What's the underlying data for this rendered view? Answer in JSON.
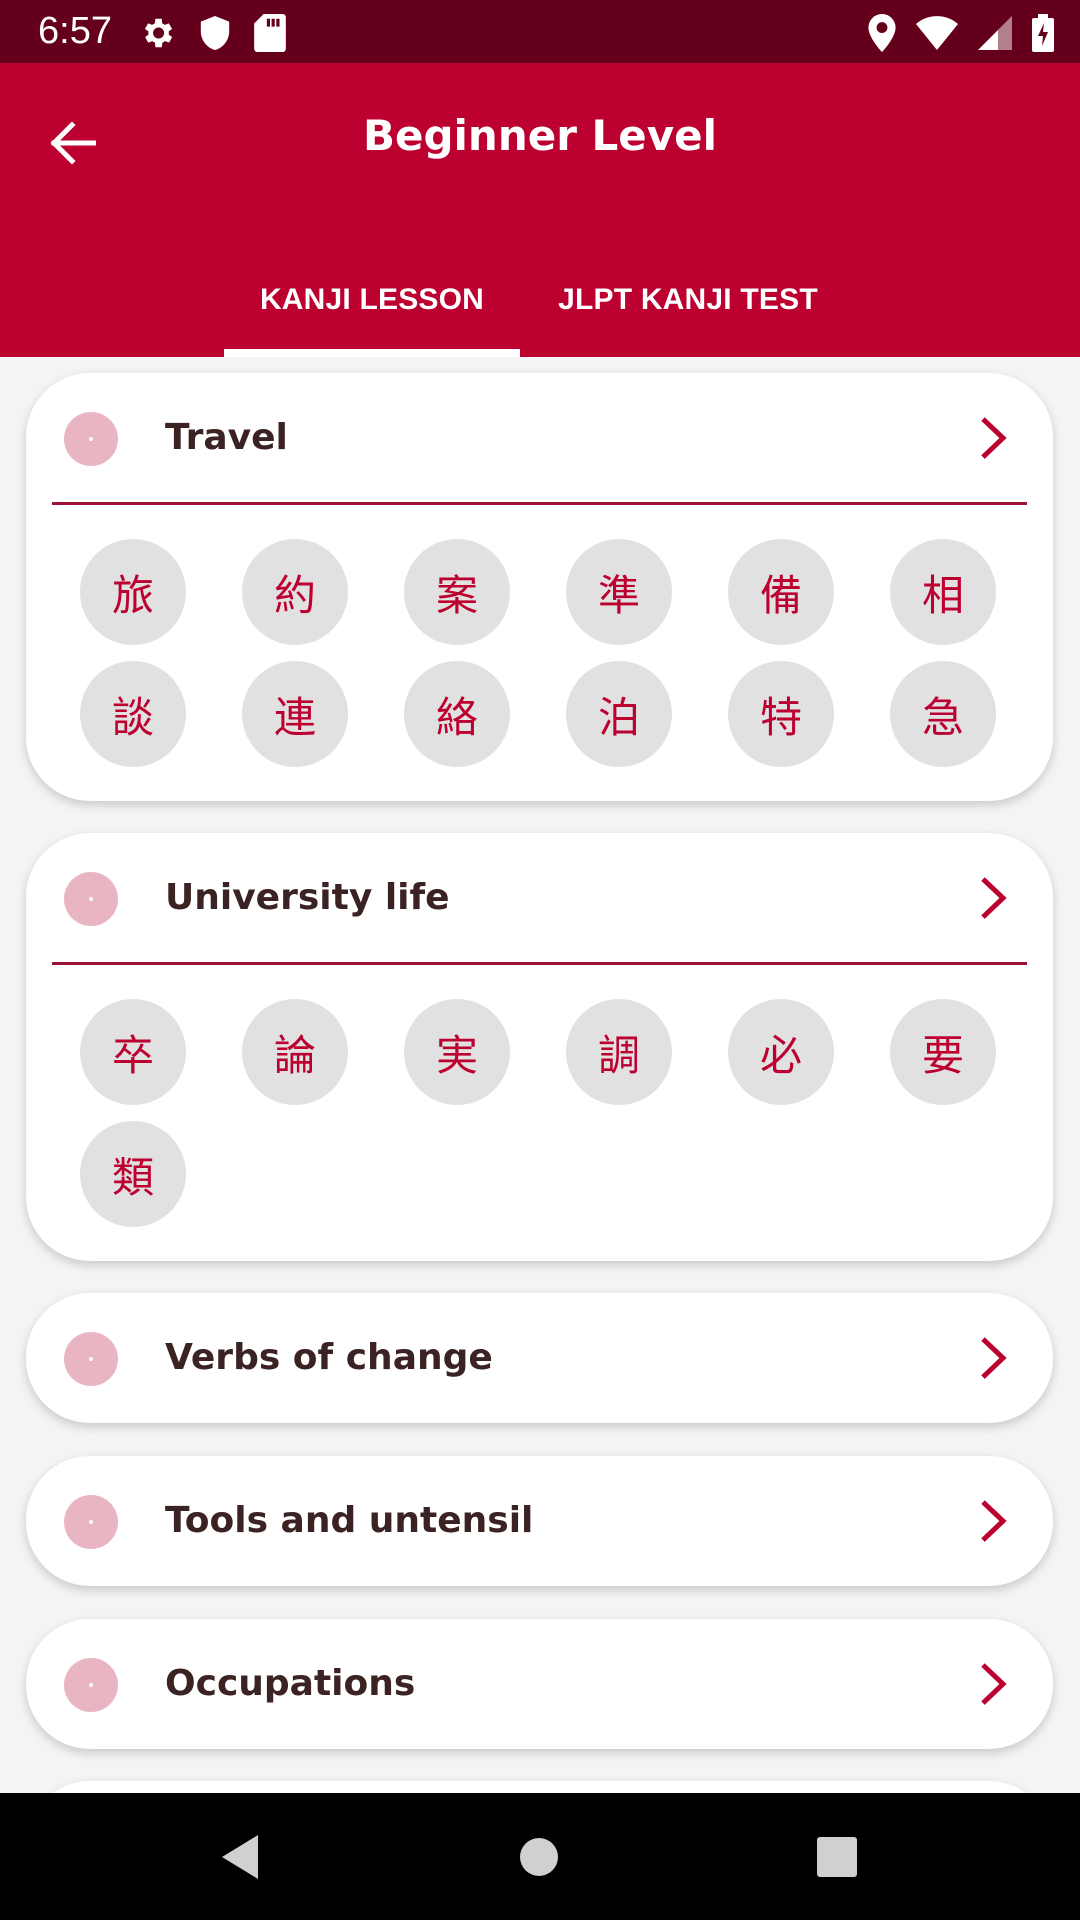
{
  "status": {
    "time": "6:57"
  },
  "header": {
    "title": "Beginner Level"
  },
  "tabs": [
    {
      "label": "KANJI LESSON",
      "selected": true
    },
    {
      "label": "JLPT KANJI TEST",
      "selected": false
    }
  ],
  "lessons": [
    {
      "title": "Travel",
      "kanji": [
        "旅",
        "約",
        "案",
        "準",
        "備",
        "相",
        "談",
        "連",
        "絡",
        "泊",
        "特",
        "急"
      ]
    },
    {
      "title": "University life",
      "kanji": [
        "卒",
        "論",
        "実",
        "調",
        "必",
        "要",
        "類"
      ]
    },
    {
      "title": "Verbs of change"
    },
    {
      "title": "Tools and untensil"
    },
    {
      "title": "Occupations"
    }
  ],
  "colors": {
    "primary": "#bc0030",
    "status_bar": "#65001c",
    "dot": "#e9b5c3",
    "chip": "#e1e1e1",
    "title_text": "#3b2223"
  },
  "icons": {
    "back": "arrow-left-icon",
    "expand": "chevron-right-icon"
  }
}
